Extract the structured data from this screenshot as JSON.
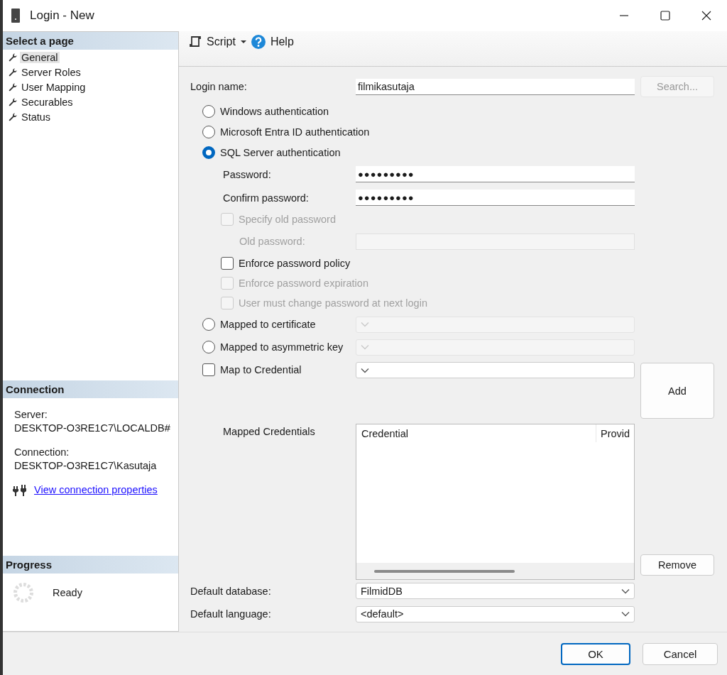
{
  "window": {
    "title": "Login - New"
  },
  "sidebar": {
    "heading": "Select a page",
    "items": [
      {
        "label": "General",
        "selected": true
      },
      {
        "label": "Server Roles",
        "selected": false
      },
      {
        "label": "User Mapping",
        "selected": false
      },
      {
        "label": "Securables",
        "selected": false
      },
      {
        "label": "Status",
        "selected": false
      }
    ]
  },
  "connection": {
    "heading": "Connection",
    "server_label": "Server:",
    "server": "DESKTOP-O3RE1C7\\LOCALDB#",
    "connection_label": "Connection:",
    "connection": "DESKTOP-O3RE1C7\\Kasutaja",
    "link": "View connection properties"
  },
  "progress": {
    "heading": "Progress",
    "status": "Ready"
  },
  "toolbar": {
    "script": "Script",
    "help": "Help"
  },
  "login_name": {
    "label": "Login name:",
    "value": "filmikasutaja"
  },
  "search_button": {
    "label": "Search...",
    "disabled": true
  },
  "auth_options": [
    {
      "label": "Windows authentication",
      "selected": false
    },
    {
      "label": "Microsoft Entra ID authentication",
      "selected": false
    },
    {
      "label": "SQL Server authentication",
      "selected": true
    }
  ],
  "password": {
    "label": "Password:",
    "value": "●●●●●●●●●"
  },
  "confirm_password": {
    "label": "Confirm password:",
    "value": "●●●●●●●●●"
  },
  "options": [
    {
      "kind": "checkbox",
      "label": "Specify old password",
      "checked": false,
      "disabled": true
    },
    {
      "kind": "field",
      "label": "Old password:",
      "disabled": true
    },
    {
      "kind": "checkbox",
      "label": "Enforce password policy",
      "checked": false,
      "disabled": false
    },
    {
      "kind": "checkbox",
      "label": "Enforce password expiration",
      "checked": false,
      "disabled": true
    },
    {
      "kind": "checkbox",
      "label": "User must change password at next login",
      "checked": false,
      "disabled": true
    }
  ],
  "mappings": [
    {
      "kind": "radio",
      "label": "Mapped to certificate",
      "selected": false,
      "disabled": true
    },
    {
      "kind": "radio",
      "label": "Mapped to asymmetric key",
      "selected": false,
      "disabled": true
    }
  ],
  "map_credential": {
    "label": "Map to Credential",
    "checked": false
  },
  "add_button": "Add",
  "mapped_credentials": {
    "label": "Mapped Credentials",
    "columns": [
      "Credential",
      "Provid"
    ]
  },
  "remove_button": "Remove",
  "default_database": {
    "label": "Default database:",
    "value": "FilmidDB"
  },
  "default_language": {
    "label": "Default language:",
    "value": "<default>"
  },
  "buttons": [
    {
      "label": "OK",
      "default": true
    },
    {
      "label": "Cancel",
      "default": false
    }
  ]
}
